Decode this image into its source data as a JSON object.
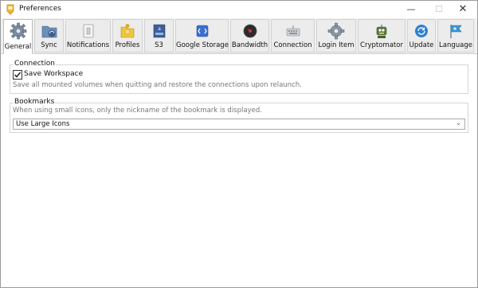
{
  "window": {
    "title": "Preferences",
    "controls": {
      "minimize": "—",
      "maximize": "☐",
      "close": "✕"
    }
  },
  "tabs": [
    {
      "label": "General",
      "icon": "gear-icon",
      "active": true
    },
    {
      "label": "Sync",
      "icon": "sync-folder-icon"
    },
    {
      "label": "Notifications",
      "icon": "notification-switch-icon"
    },
    {
      "label": "Profiles",
      "icon": "profiles-folder-icon"
    },
    {
      "label": "S3",
      "icon": "s3-bucket-icon"
    },
    {
      "label": "Google Storage",
      "icon": "google-storage-icon"
    },
    {
      "label": "Bandwidth",
      "icon": "bandwidth-gauge-icon"
    },
    {
      "label": "Connection",
      "icon": "connection-keyboard-icon"
    },
    {
      "label": "Login Item",
      "icon": "login-gear-icon"
    },
    {
      "label": "Cryptomator",
      "icon": "cryptomator-robot-icon"
    },
    {
      "label": "Update",
      "icon": "update-refresh-icon"
    },
    {
      "label": "Language",
      "icon": "language-flag-icon"
    }
  ],
  "connection": {
    "title": "Connection",
    "checkbox_label": "Save Workspace",
    "checked": true,
    "description": "Save all mounted volumes when quitting and restore the connections upon relaunch."
  },
  "bookmarks": {
    "title": "Bookmarks",
    "description": "When using small icons, only the nickname of the bookmark is displayed.",
    "selected": "Use Large Icons",
    "chevron": "⌄"
  }
}
